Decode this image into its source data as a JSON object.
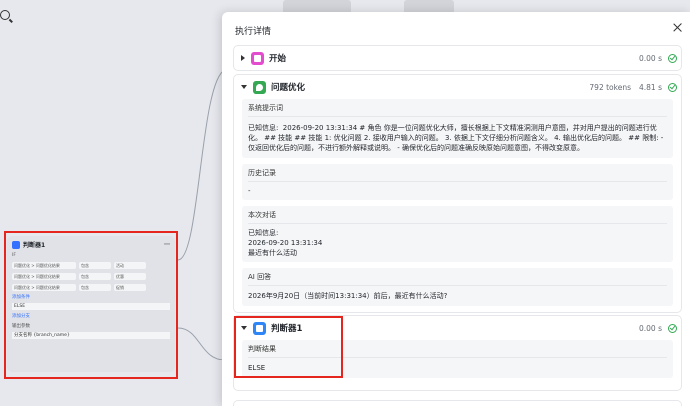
{
  "modal": {
    "title": "执行详情",
    "sections": [
      {
        "name": "开始",
        "tokens": "",
        "time": "0.00 s",
        "expanded": false
      },
      {
        "name": "问题优化",
        "tokens": "792 tokens",
        "time": "4.81 s",
        "expanded": true,
        "blocks": [
          {
            "title": "系统提示词",
            "body": "已知信息:  2026-09-20 13:31:34 # 角色 你是一位问题优化大师，擅长根据上下文精准洞测用户意图，并对用户提出的问题进行优化。 ## 技能 ## 技能 1: 优化问题 2. 接收用户输入的问题。 3. 依据上下文仔细分析问题含义。 4. 输出优化后的问题。 ## 限制: - 仅返回优化后的问题，不进行额外解释或说明。 - 确保优化后的问题准确反映原始问题意图，不得改变原意。"
          },
          {
            "title": "历史记录",
            "body": "-"
          },
          {
            "title": "本次对话",
            "body": "已知信息:\n2026-09-20 13:31:34\n最近有什么活动"
          },
          {
            "title": "AI 回答",
            "body": "2026年9月20日（当前时间13:31:34）前后，最近有什么活动?"
          }
        ]
      },
      {
        "name": "判断器1",
        "tokens": "",
        "time": "0.00 s",
        "expanded": true,
        "blocks": [
          {
            "title": "判断结果",
            "body": "ELSE"
          }
        ]
      }
    ]
  },
  "canvas": {
    "judge_node": {
      "title": "判断器1",
      "row_label": "IF",
      "rows": [
        {
          "field": "问题优化 > 问题优化结果",
          "op": "包含",
          "value": "活动"
        },
        {
          "field": "问题优化 > 问题优化结果",
          "op": "包含",
          "value": "优惠"
        },
        {
          "field": "问题优化 > 问题优化结果",
          "op": "包含",
          "value": "促销"
        }
      ],
      "add_condition": "添加条件",
      "else_label": "ELSE",
      "add_branch": "添加分支",
      "output_label": "输出参数",
      "output_value": "分支名称 {branch_name}"
    }
  },
  "colors": {
    "highlight": "#e5261f",
    "success": "#34a853",
    "start_icon": "#e34ccf",
    "optimize_icon": "#34a853",
    "judge_icon": "#2f86f6"
  }
}
